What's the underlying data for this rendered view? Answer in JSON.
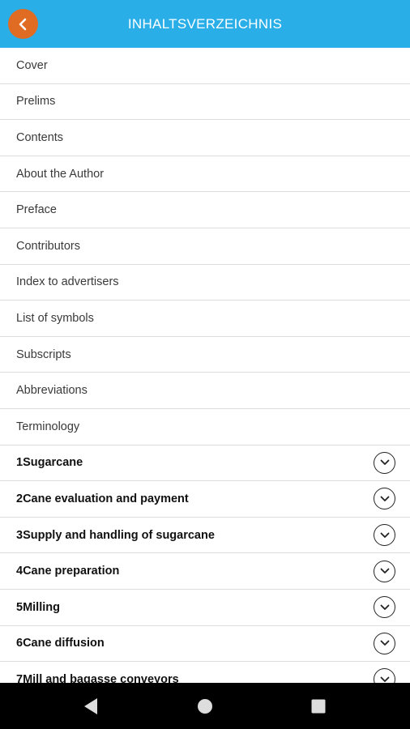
{
  "header": {
    "title": "INHALTSVERZEICHNIS",
    "back_icon": "chevron-left-icon",
    "bar_color": "#29aee8",
    "back_color": "#e06b22"
  },
  "toc": {
    "sections": [
      "Cover",
      "Prelims",
      "Contents",
      "About the Author",
      "Preface",
      "Contributors",
      "Index to advertisers",
      "List of symbols",
      "Subscripts",
      "Abbreviations",
      "Terminology"
    ],
    "chapters": [
      "1Sugarcane",
      "2Cane evaluation and payment",
      "3Supply and handling of sugarcane",
      "4Cane preparation",
      "5Milling",
      "6Cane diffusion",
      "7Mill and bagasse conveyors"
    ],
    "expand_icon": "chevron-down-circle-icon"
  },
  "navbar": {
    "back_icon": "triangle-back-icon",
    "home_icon": "circle-home-icon",
    "recents_icon": "square-recents-icon"
  }
}
